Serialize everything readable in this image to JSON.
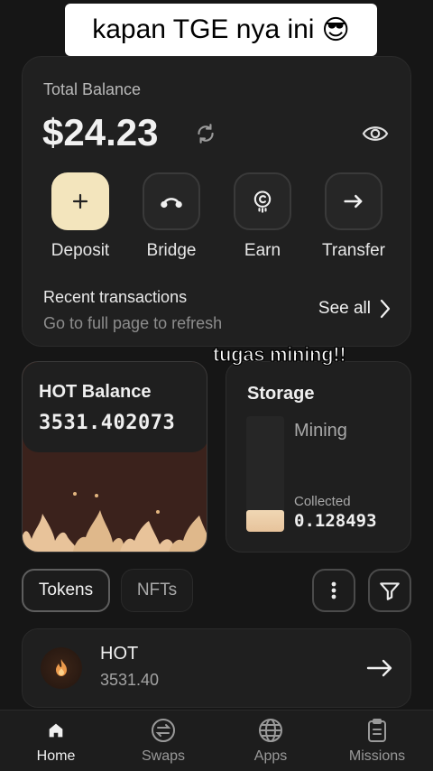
{
  "overlay": {
    "caption": "kapan TGE nya ini",
    "caption_emoji": "😎",
    "mining_note": "tugas mining!!"
  },
  "wallet": {
    "total_label": "Total Balance",
    "total_amount": "$24.23",
    "actions": [
      {
        "label": "Deposit",
        "icon": "plus-icon"
      },
      {
        "label": "Bridge",
        "icon": "bridge-icon"
      },
      {
        "label": "Earn",
        "icon": "earn-coin-icon"
      },
      {
        "label": "Transfer",
        "icon": "arrow-right-icon"
      }
    ],
    "recent_title": "Recent transactions",
    "recent_sub": "Go to full page to refresh",
    "see_all": "See all"
  },
  "hot": {
    "title": "HOT Balance",
    "value": "3531.402073"
  },
  "storage": {
    "title": "Storage",
    "mining_label": "Mining",
    "collected_label": "Collected",
    "collected_value": "0.128493",
    "fill_fraction": 0.19
  },
  "tabs": [
    "Tokens",
    "NFTs"
  ],
  "tokens": [
    {
      "name": "HOT",
      "amount": "3531.40",
      "icon": "hot-flame-icon"
    }
  ],
  "nav": [
    {
      "label": "Home",
      "icon": "home-icon",
      "active": true
    },
    {
      "label": "Swaps",
      "icon": "swap-icon",
      "active": false
    },
    {
      "label": "Apps",
      "icon": "globe-icon",
      "active": false
    },
    {
      "label": "Missions",
      "icon": "clipboard-icon",
      "active": false
    }
  ],
  "colors": {
    "accent": "#f3e5bd",
    "background": "#161616",
    "card": "#202020"
  }
}
